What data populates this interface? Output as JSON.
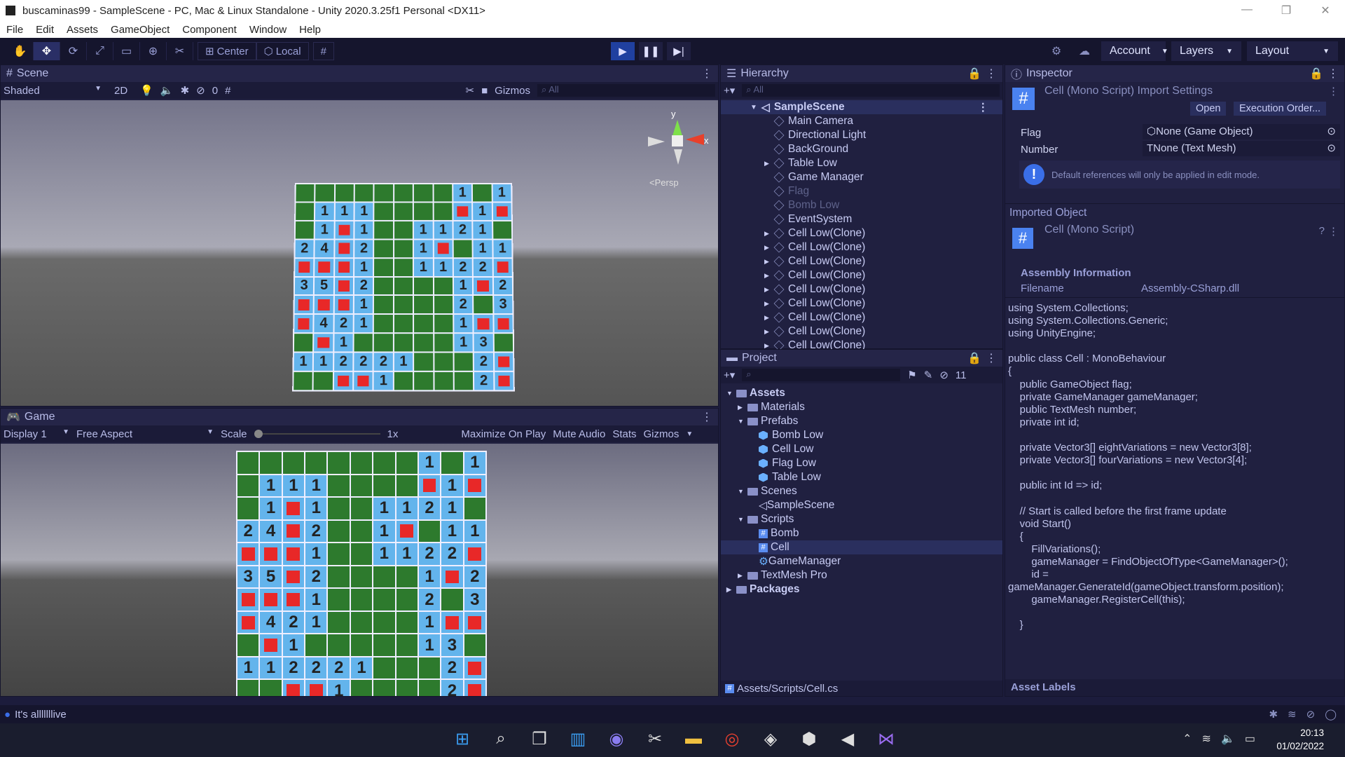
{
  "window": {
    "title": "buscaminas99 - SampleScene - PC, Mac & Linux Standalone - Unity 2020.3.25f1 Personal <DX11>"
  },
  "menu": [
    "File",
    "Edit",
    "Assets",
    "GameObject",
    "Component",
    "Window",
    "Help"
  ],
  "toolbar": {
    "center": "Center",
    "local": "Local",
    "account": "Account",
    "layers": "Layers",
    "layout": "Layout"
  },
  "scene": {
    "tab": "Scene",
    "shading": "Shaded",
    "mode2d": "2D",
    "hidden_count": "0",
    "gizmos": "Gizmos",
    "search_placeholder": "All",
    "persp": "<Persp",
    "axis_y": "y",
    "axis_x": "x"
  },
  "game": {
    "tab": "Game",
    "display": "Display 1",
    "aspect": "Free Aspect",
    "scale_label": "Scale",
    "scale_value": "1x",
    "maximize": "Maximize On Play",
    "mute": "Mute Audio",
    "stats": "Stats",
    "gizmos": "Gizmos"
  },
  "board": [
    "gggggggg1g1",
    "g111ggggX1X1",
    "g1X1gg1121g",
    "24X2gg1Xg11",
    "XXX1gg112 2X",
    "35X2gggg1X2",
    "XXX1gggg2g3",
    "X421gggg1XX",
    "gX1ggggg13g",
    "112221ggg2X",
    "ggXX1gggg2X"
  ],
  "hierarchy": {
    "tab": "Hierarchy",
    "search_placeholder": "All",
    "scene": "SampleScene",
    "items": [
      {
        "label": "Main Camera",
        "dim": false,
        "arrow": false
      },
      {
        "label": "Directional Light",
        "dim": false,
        "arrow": false
      },
      {
        "label": "BackGround",
        "dim": false,
        "arrow": false
      },
      {
        "label": "Table Low",
        "dim": false,
        "arrow": true
      },
      {
        "label": "Game Manager",
        "dim": false,
        "arrow": false
      },
      {
        "label": "Flag",
        "dim": true,
        "arrow": false
      },
      {
        "label": "Bomb Low",
        "dim": true,
        "arrow": false
      },
      {
        "label": "EventSystem",
        "dim": false,
        "arrow": false
      },
      {
        "label": "Cell Low(Clone)",
        "dim": false,
        "arrow": true
      },
      {
        "label": "Cell Low(Clone)",
        "dim": false,
        "arrow": true
      },
      {
        "label": "Cell Low(Clone)",
        "dim": false,
        "arrow": true
      },
      {
        "label": "Cell Low(Clone)",
        "dim": false,
        "arrow": true
      },
      {
        "label": "Cell Low(Clone)",
        "dim": false,
        "arrow": true
      },
      {
        "label": "Cell Low(Clone)",
        "dim": false,
        "arrow": true
      },
      {
        "label": "Cell Low(Clone)",
        "dim": false,
        "arrow": true
      },
      {
        "label": "Cell Low(Clone)",
        "dim": false,
        "arrow": true
      },
      {
        "label": "Cell Low(Clone)",
        "dim": false,
        "arrow": true
      }
    ]
  },
  "project": {
    "tab": "Project",
    "hidden_count": "11",
    "path": "Assets/Scripts/Cell.cs",
    "tree": [
      {
        "label": "Assets",
        "indent": 0,
        "type": "folder",
        "bold": true
      },
      {
        "label": "Materials",
        "indent": 1,
        "type": "folder"
      },
      {
        "label": "Prefabs",
        "indent": 1,
        "type": "folder"
      },
      {
        "label": "Bomb Low",
        "indent": 2,
        "type": "prefab"
      },
      {
        "label": "Cell Low",
        "indent": 2,
        "type": "prefab"
      },
      {
        "label": "Flag Low",
        "indent": 2,
        "type": "prefab"
      },
      {
        "label": "Table Low",
        "indent": 2,
        "type": "prefab"
      },
      {
        "label": "Scenes",
        "indent": 1,
        "type": "folder"
      },
      {
        "label": "SampleScene",
        "indent": 2,
        "type": "scene"
      },
      {
        "label": "Scripts",
        "indent": 1,
        "type": "folder"
      },
      {
        "label": "Bomb",
        "indent": 2,
        "type": "script"
      },
      {
        "label": "Cell",
        "indent": 2,
        "type": "script",
        "selected": true
      },
      {
        "label": "GameManager",
        "indent": 2,
        "type": "gear"
      },
      {
        "label": "TextMesh Pro",
        "indent": 1,
        "type": "folder"
      },
      {
        "label": "Packages",
        "indent": 0,
        "type": "folder",
        "bold": true
      }
    ]
  },
  "inspector": {
    "tab": "Inspector",
    "title": "Cell (Mono Script) Import Settings",
    "open": "Open",
    "exec_order": "Execution Order...",
    "flag_label": "Flag",
    "flag_value": "None (Game Object)",
    "number_label": "Number",
    "number_value": "None (Text Mesh)",
    "info": "Default references will only be applied in edit mode.",
    "imported": "Imported Object",
    "script_name": "Cell (Mono Script)",
    "assembly_header": "Assembly Information",
    "filename_label": "Filename",
    "filename_value": "Assembly-CSharp.dll",
    "code": "using System.Collections;\nusing System.Collections.Generic;\nusing UnityEngine;\n\npublic class Cell : MonoBehaviour\n{\n    public GameObject flag;\n    private GameManager gameManager;\n    public TextMesh number;\n    private int id;\n\n    private Vector3[] eightVariations = new Vector3[8];\n    private Vector3[] fourVariations = new Vector3[4];\n\n    public int Id => id;\n\n    // Start is called before the first frame update\n    void Start()\n    {\n        FillVariations();\n        gameManager = FindObjectOfType<GameManager>();\n        id =\ngameManager.GenerateId(gameObject.transform.position);\n        gameManager.RegisterCell(this);\n\n    }",
    "asset_labels": "Asset Labels"
  },
  "status": {
    "message": "It's alllllllive"
  },
  "taskbar": {
    "time": "20:13",
    "date": "01/02/2022"
  }
}
